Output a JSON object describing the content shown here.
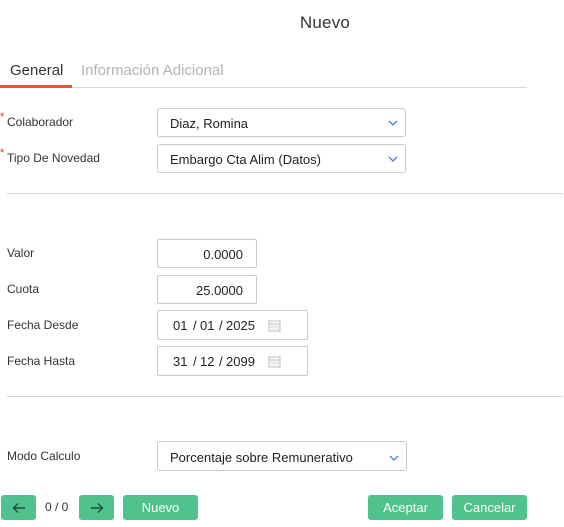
{
  "window": {
    "title": "Nuevo"
  },
  "tabs": {
    "general": "General",
    "info": "Información Adicional"
  },
  "fields": {
    "colaborador": {
      "label": "Colaborador",
      "value": "Diaz, Romina",
      "required": "*"
    },
    "tipo": {
      "label": "Tipo De Novedad",
      "value": "Embargo Cta Alim (Datos)",
      "required": "*"
    },
    "valor": {
      "label": "Valor",
      "value": "0.0000"
    },
    "cuota": {
      "label": "Cuota",
      "value": "25.0000"
    },
    "fecha_desde": {
      "label": "Fecha Desde",
      "day": "01",
      "month": "01",
      "year": "2025"
    },
    "fecha_hasta": {
      "label": "Fecha Hasta",
      "day": "31",
      "month": "12",
      "year": "2099"
    },
    "modo": {
      "label": "Modo Calculo",
      "value": "Porcentaje sobre Remunerativo"
    }
  },
  "date_separator": "/",
  "footer": {
    "pager": "0 / 0",
    "nuevo": "Nuevo",
    "aceptar": "Aceptar",
    "cancelar": "Cancelar"
  },
  "icons": {
    "prev": "arrow-left-icon",
    "next": "arrow-right-icon",
    "dropdown": "chevron-down-icon",
    "calendar": "calendar-icon"
  },
  "colors": {
    "accent": "#4fc28e",
    "tab_underline": "#e4572e",
    "required": "#e33333",
    "chevron": "#4a7fd4"
  }
}
